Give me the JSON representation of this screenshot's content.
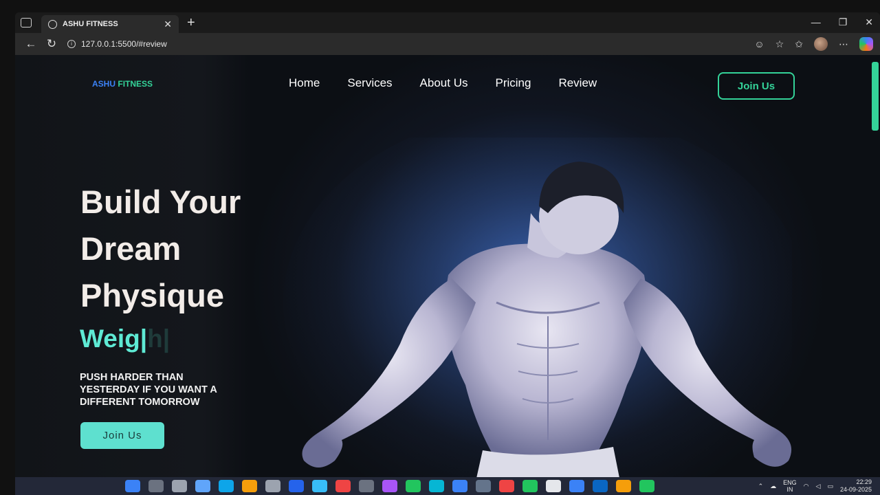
{
  "browser": {
    "tab_title": "ASHU FITNESS",
    "url": "127.0.0.1:5500/#review"
  },
  "site": {
    "logo_part1": "ASHU",
    "logo_part2": "FITNESS",
    "nav": [
      "Home",
      "Services",
      "About Us",
      "Pricing",
      "Review"
    ],
    "join_top": "Join Us"
  },
  "hero": {
    "title_lines": [
      "Build Your",
      "Dream",
      "Physique"
    ],
    "typing_text": "Weig",
    "typing_ghost": "h",
    "tagline": "PUSH HARDER THAN YESTERDAY IF YOU WANT A DIFFERENT TOMORROW",
    "join_button": "Join Us"
  },
  "taskbar": {
    "lang_line1": "ENG",
    "lang_line2": "IN",
    "time": "22:29",
    "date": "24-09-2025"
  },
  "colors": {
    "accent_green": "#34d399",
    "accent_blue": "#3b82f6",
    "teal_button": "#5ee0cf"
  }
}
